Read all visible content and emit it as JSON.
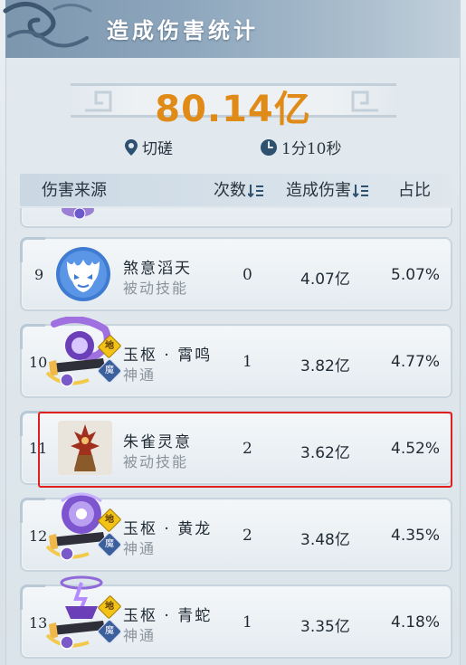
{
  "header": {
    "title": "造成伤害统计"
  },
  "summary": {
    "total_damage": "80.14亿",
    "location": "切磋",
    "duration": "1分10秒"
  },
  "columns": {
    "source": "伤害来源",
    "count": "次数",
    "damage": "造成伤害",
    "ratio": "占比"
  },
  "rows": [
    {
      "rank": "9",
      "name": "煞意滔天",
      "type": "被动技能",
      "count": "0",
      "damage": "4.07亿",
      "ratio": "5.07%",
      "icon": "demon-mask-icon"
    },
    {
      "rank": "10",
      "name": "玉枢 · 霄鸣",
      "type": "神通",
      "count": "1",
      "damage": "3.82亿",
      "ratio": "4.77%",
      "icon": "purple-vortex-icon",
      "badge_land": "地",
      "badge_demon": "魔"
    },
    {
      "rank": "11",
      "name": "朱雀灵意",
      "type": "被动技能",
      "count": "2",
      "damage": "3.62亿",
      "ratio": "4.52%",
      "icon": "vermilion-bird-icon"
    },
    {
      "rank": "12",
      "name": "玉枢 · 黄龙",
      "type": "神通",
      "count": "2",
      "damage": "3.48亿",
      "ratio": "4.35%",
      "icon": "purple-orb-icon",
      "badge_land": "地",
      "badge_demon": "魔"
    },
    {
      "rank": "13",
      "name": "玉枢 · 青蛇",
      "type": "神通",
      "count": "1",
      "damage": "3.35亿",
      "ratio": "4.18%",
      "icon": "purple-lightning-icon",
      "badge_land": "地",
      "badge_demon": "魔"
    }
  ],
  "colors": {
    "total": "#e08a17",
    "highlight_border": "#e02020",
    "header_bar": "#8ea7bd"
  }
}
